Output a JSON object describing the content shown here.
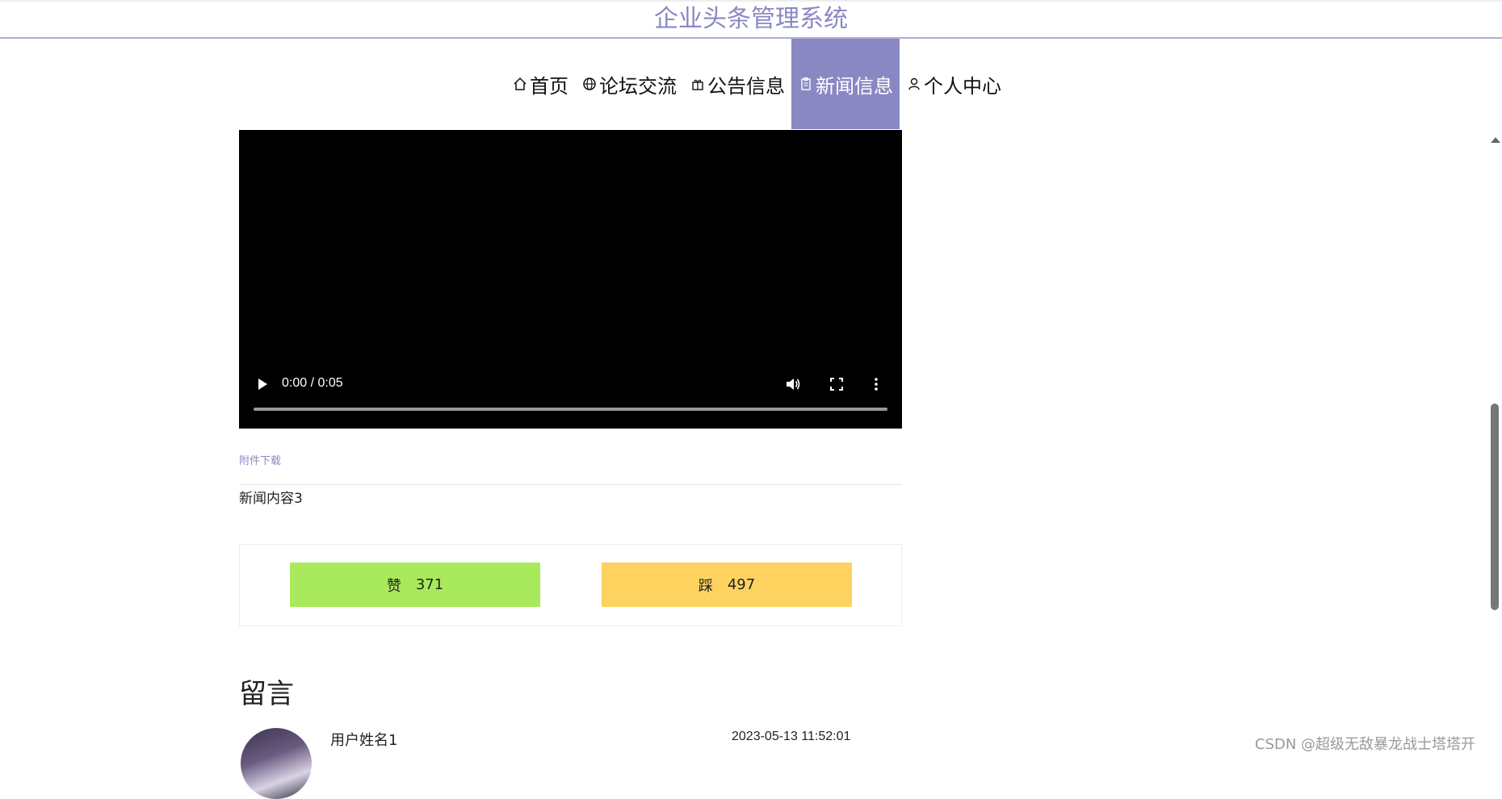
{
  "app": {
    "title": "企业头条管理系统"
  },
  "nav": {
    "items": [
      {
        "label": "首页",
        "icon": "home-icon",
        "active": false
      },
      {
        "label": "论坛交流",
        "icon": "globe-icon",
        "active": false
      },
      {
        "label": "公告信息",
        "icon": "gift-icon",
        "active": false
      },
      {
        "label": "新闻信息",
        "icon": "clipboard-icon",
        "active": true
      },
      {
        "label": "个人中心",
        "icon": "user-icon",
        "active": false
      }
    ]
  },
  "video": {
    "time": "0:00 / 0:05",
    "progress": 0
  },
  "attachment": {
    "label": "附件下载"
  },
  "news": {
    "content": "新闻内容3"
  },
  "vote": {
    "like_label": "赞",
    "like_count": "371",
    "dislike_label": "踩",
    "dislike_count": "497"
  },
  "comments": {
    "title": "留言",
    "items": [
      {
        "user": "用户姓名1",
        "time": "2023-05-13 11:52:01"
      }
    ]
  },
  "watermark": "CSDN @超级无敌暴龙战士塔塔开",
  "colors": {
    "accent": "#8a88c3",
    "like": "#a8ea5c",
    "dislike": "#fed25f"
  }
}
